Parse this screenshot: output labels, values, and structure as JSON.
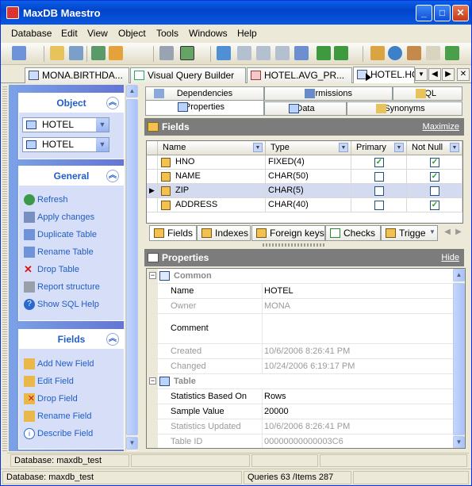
{
  "window": {
    "title": "MaxDB Maestro"
  },
  "menu": [
    "Database",
    "Edit",
    "View",
    "Object",
    "Tools",
    "Windows",
    "Help"
  ],
  "doc_tabs": [
    {
      "label": "MONA.BIRTHDA..."
    },
    {
      "label": "Visual Query Builder"
    },
    {
      "label": "HOTEL.AVG_PR..."
    },
    {
      "label": "HOTEL.HO"
    }
  ],
  "left_panel": {
    "object": {
      "title": "Object",
      "schema_value": "HOTEL",
      "table_value": "HOTEL"
    },
    "general": {
      "title": "General",
      "items": [
        "Refresh",
        "Apply changes",
        "Duplicate Table",
        "Rename Table",
        "Drop Table",
        "Report structure",
        "Show SQL Help"
      ]
    },
    "fields": {
      "title": "Fields",
      "items": [
        "Add New Field",
        "Edit Field",
        "Drop Field",
        "Rename Field",
        "Describe Field"
      ]
    }
  },
  "content_tabs": {
    "row1": [
      "Dependencies",
      "Permissions",
      "SQL"
    ],
    "row2": [
      "Properties",
      "Data",
      "Synonyms"
    ]
  },
  "fields_section": {
    "title": "Fields",
    "action": "Maximize",
    "columns": [
      "Name",
      "Type",
      "Primary",
      "Not Null"
    ],
    "rows": [
      {
        "name": "HNO",
        "type": "FIXED(4)",
        "primary": true,
        "not_null": true
      },
      {
        "name": "NAME",
        "type": "CHAR(50)",
        "primary": false,
        "not_null": true
      },
      {
        "name": "ZIP",
        "type": "CHAR(5)",
        "primary": false,
        "not_null": false
      },
      {
        "name": "ADDRESS",
        "type": "CHAR(40)",
        "primary": false,
        "not_null": true
      }
    ]
  },
  "bottom_tabs": [
    "Fields",
    "Indexes",
    "Foreign keys",
    "Checks",
    "Trigge"
  ],
  "properties_section": {
    "title": "Properties",
    "action": "Hide",
    "groups": [
      {
        "name": "Common",
        "rows": [
          {
            "key": "Name",
            "value": "HOTEL",
            "disabled": false
          },
          {
            "key": "Owner",
            "value": "MONA",
            "disabled": true
          },
          {
            "key": "Comment",
            "value": "",
            "disabled": false
          },
          {
            "key": "Created",
            "value": "10/6/2006 8:26:41 PM",
            "disabled": true
          },
          {
            "key": "Changed",
            "value": "10/24/2006 6:19:17 PM",
            "disabled": true
          }
        ]
      },
      {
        "name": "Table",
        "rows": [
          {
            "key": "Statistics Based On",
            "value": "Rows",
            "disabled": false
          },
          {
            "key": "Sample Value",
            "value": "20000",
            "disabled": false
          },
          {
            "key": "Statistics Updated",
            "value": "10/6/2006 8:26:41 PM",
            "disabled": true
          },
          {
            "key": "Table ID",
            "value": "00000000000003C6",
            "disabled": true
          }
        ]
      }
    ]
  },
  "status": {
    "inner": "Database: maxdb_test",
    "database": "Database: maxdb_test",
    "queries": "Queries 63 /Items 287"
  }
}
